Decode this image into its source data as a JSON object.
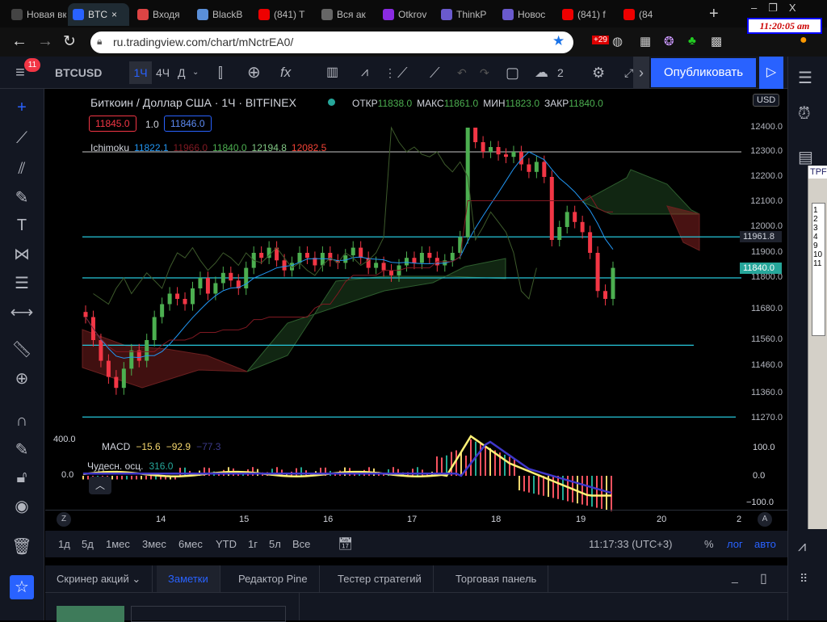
{
  "browser": {
    "tabs": [
      {
        "label": "Новая вкла",
        "color": "#444"
      },
      {
        "label": "BTC",
        "color": "#2962ff",
        "active": true
      },
      {
        "label": "Входя",
        "color": "#d44"
      },
      {
        "label": "BlackB",
        "color": "#5a8fd8"
      },
      {
        "label": "(841) T",
        "color": "#e00"
      },
      {
        "label": "Вся ак",
        "color": "#666"
      },
      {
        "label": "Otkrov",
        "color": "#8a2be2"
      },
      {
        "label": "ThinkP",
        "color": "#6a5acd"
      },
      {
        "label": "Новос",
        "color": "#6a5acd"
      },
      {
        "label": "(841) f",
        "color": "#e00"
      },
      {
        "label": "(84",
        "color": "#e00"
      }
    ],
    "new_tab": "+",
    "url": "ru.tradingview.com/chart/mNctrEA0/",
    "clock": "11:20:05 am",
    "ext_badge": "+29",
    "window_controls": [
      "–",
      "❐",
      "X"
    ]
  },
  "toolbar": {
    "notifications": "11",
    "symbol": "BTCUSD",
    "intervals": [
      "1Ч",
      "4Ч",
      "Д"
    ],
    "active_interval": "1Ч",
    "layout_count": "2",
    "publish": "Опубликовать"
  },
  "chart": {
    "title": "Биткоин / Доллар США · 1Ч · BITFINEX",
    "ohlc": [
      {
        "k": "ОТКР",
        "v": "11838.0"
      },
      {
        "k": "МАКС",
        "v": "11861.0"
      },
      {
        "k": "МИН",
        "v": "11823.0"
      },
      {
        "k": "ЗАКР",
        "v": "11840.0"
      }
    ],
    "bid": "11845.0",
    "spread": "1.0",
    "ask": "11846.0",
    "ichimoku": {
      "name": "Ichimoku",
      "values": [
        {
          "v": "11822.1",
          "c": "#2196f3"
        },
        {
          "v": "11966.0",
          "c": "#801922"
        },
        {
          "v": "11840.0",
          "c": "#4caf50"
        },
        {
          "v": "12194.8",
          "c": "#81c784"
        },
        {
          "v": "12082.5",
          "c": "#f44336"
        }
      ]
    },
    "currency": "USD",
    "macd": {
      "name": "MACD",
      "v1": "−15.6",
      "v2": "−92.9",
      "v3": "−77.3"
    },
    "ao": {
      "name": "Чудесн. осц.",
      "v": "316.0"
    },
    "macd_scale": [
      "100.0",
      "0.0",
      "−100.0"
    ],
    "ao_scale": [
      "400.0",
      "0.0"
    ],
    "time_labels": [
      "14",
      "15",
      "16",
      "17",
      "18",
      "19",
      "20",
      "2"
    ],
    "badges": {
      "z": "Z",
      "a": "A"
    }
  },
  "chart_data": {
    "type": "candlestick",
    "title": "Биткоин / Доллар США · 1Ч · BITFINEX",
    "price_ticks": [
      12400,
      12300,
      12200,
      12100,
      12000,
      11900,
      11800,
      11680,
      11560,
      11460,
      11360,
      11270
    ],
    "price_labels": [
      "12400.0",
      "12300.0",
      "12200.0",
      "12100.0",
      "12000.0",
      "11900.0",
      "11800.0",
      "11680.0",
      "11560.0",
      "11460.0",
      "11360.0",
      "11270.0"
    ],
    "last_price": "11840.0",
    "line_label": "11961.8",
    "hlines": [
      {
        "price": 12300,
        "color": "#9e9e9e"
      },
      {
        "price": 11961.8,
        "color": "#26c6da"
      },
      {
        "price": 11800,
        "color": "#26c6da"
      },
      {
        "price": 11540,
        "color": "#26c6da",
        "ray": true
      },
      {
        "price": 11275,
        "color": "#26c6da",
        "ray": true
      }
    ],
    "closes": [
      11650,
      11560,
      11480,
      11420,
      11380,
      11450,
      11520,
      11480,
      11560,
      11650,
      11700,
      11740,
      11720,
      11700,
      11760,
      11800,
      11740,
      11780,
      11820,
      11790,
      11760,
      11840,
      11900,
      11880,
      11920,
      11870,
      11830,
      11860,
      11900,
      11880,
      11850,
      11900,
      11870,
      11860,
      11890,
      11920,
      11880,
      11840,
      11860,
      11830,
      11810,
      11850,
      11880,
      11860,
      11900,
      11880,
      11850,
      11870,
      11900,
      11960,
      12400,
      12340,
      12300,
      12320,
      12290,
      12280,
      12300,
      12250,
      12220,
      12260,
      12200,
      11950,
      12000,
      12060,
      12020,
      11980,
      11900,
      11750,
      11720,
      11840
    ]
  }
}
